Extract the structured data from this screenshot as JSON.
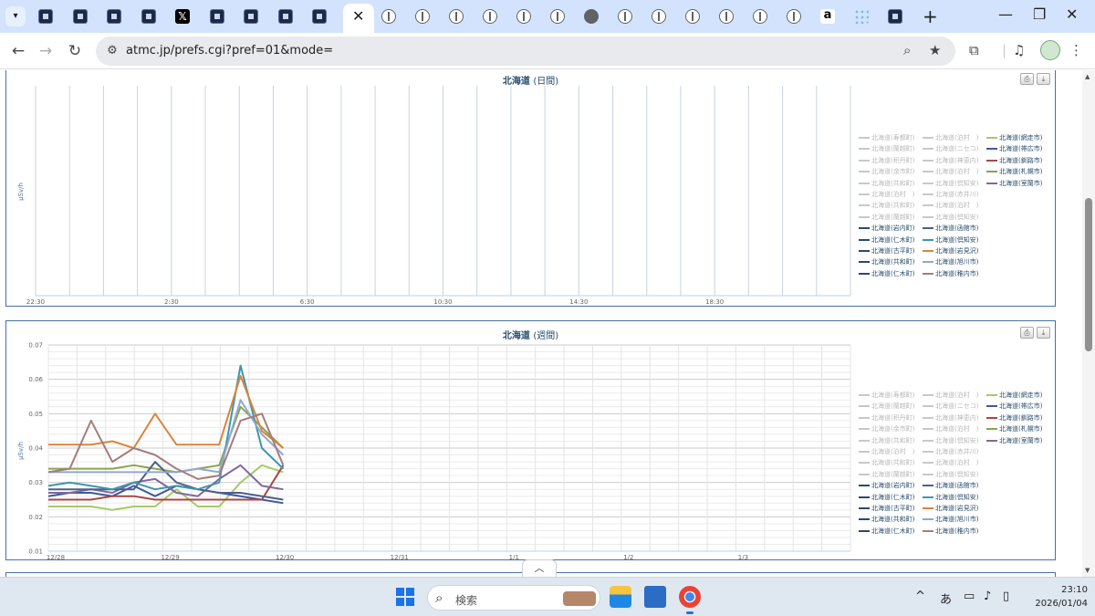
{
  "browser": {
    "url": "atmc.jp/prefs.cgi?pref=01&mode=",
    "tab_count": 27,
    "active_tab_index": 9
  },
  "page": {
    "panels": [
      {
        "title_main": "北海道",
        "title_sub": "(日間)",
        "ylabel": "µSv/h",
        "xticks": [
          "22:30",
          "2:30",
          "6:30",
          "10:30",
          "14:30",
          "18:30"
        ]
      },
      {
        "title_main": "北海道",
        "title_sub": "(週間)",
        "ylabel": "µSv/h",
        "yticks": [
          "0.07",
          "0.06",
          "0.05",
          "0.04",
          "0.03",
          "0.02",
          "0.01"
        ],
        "xticks": [
          "12/28",
          "12/29",
          "12/30",
          "12/31",
          "1/1",
          "1/2",
          "1/3"
        ]
      }
    ],
    "legend": {
      "col1": [
        "北海道(寿都町)",
        "北海道(蘭越町)",
        "北海道(积丹町)",
        "北海道(余市町)",
        "北海道(共和町)",
        "北海道(泊村　)",
        "北海道(共和町)",
        "北海道(蘭越町)",
        "北海道(岩内町)",
        "北海道(仁木町)",
        "北海道(古平町)",
        "北海道(共和町)",
        "北海道(仁木町)"
      ],
      "col2": [
        "北海道(泊村　)",
        "北海道(ニセコ)",
        "北海道(神恵内)",
        "北海道(泊村　)",
        "北海道(倶知安)",
        "北海道(赤井川)",
        "北海道(泊村　)",
        "北海道(倶知安)",
        "北海道(函館市)",
        "北海道(倶知安)",
        "北海道(岩見沢)",
        "北海道(旭川市)",
        "北海道(稚内市)"
      ],
      "col3": [
        "北海道(網走市)",
        "北海道(帯広市)",
        "北海道(釧路市)",
        "北海道(札幌市)",
        "北海道(室蘭市)"
      ]
    }
  },
  "taskbar": {
    "search_placeholder": "検索",
    "ime": "あ",
    "time": "23:10",
    "date": "2026/01/04"
  },
  "chart_data": [
    {
      "type": "line",
      "title": "北海道 (日間)",
      "ylabel": "µSv/h",
      "x": [
        "22:30",
        "2:30",
        "6:30",
        "10:30",
        "14:30",
        "18:30"
      ],
      "series": []
    },
    {
      "type": "line",
      "title": "北海道 (週間)",
      "ylabel": "µSv/h",
      "ylim": [
        0.01,
        0.07
      ],
      "x": [
        "12/28",
        "12/29",
        "12/30",
        "12/31",
        "1/1",
        "1/2",
        "1/3"
      ],
      "series": [
        {
          "name": "北海道(網走市)",
          "color": "#a6c96a",
          "values": [
            0.023,
            0.023,
            0.023,
            0.022,
            0.023,
            0.023,
            0.028,
            0.023,
            0.023,
            0.03,
            0.035,
            0.033
          ]
        },
        {
          "name": "北海道(帯広市)",
          "color": "#3d5a98",
          "values": [
            0.026,
            0.027,
            0.027,
            0.026,
            0.029,
            0.026,
            0.029,
            0.028,
            0.027,
            0.026,
            0.025,
            0.024
          ]
        },
        {
          "name": "北海道(釧路市)",
          "color": "#aa4643",
          "values": [
            0.025,
            0.025,
            0.025,
            0.026,
            0.026,
            0.025,
            0.025,
            0.025,
            0.025,
            0.025,
            0.025,
            0.035
          ]
        },
        {
          "name": "北海道(札幌市)",
          "color": "#89a54e",
          "values": [
            0.034,
            0.034,
            0.034,
            0.034,
            0.035,
            0.034,
            0.033,
            0.034,
            0.035,
            0.052,
            0.046,
            0.04
          ]
        },
        {
          "name": "北海道(室蘭市)",
          "color": "#80699b",
          "values": [
            0.027,
            0.027,
            0.028,
            0.027,
            0.03,
            0.031,
            0.027,
            0.026,
            0.031,
            0.035,
            0.029,
            0.028
          ]
        },
        {
          "name": "北海道(函館市)",
          "color": "#4d5f8a",
          "values": [
            0.028,
            0.028,
            0.028,
            0.028,
            0.028,
            0.036,
            0.03,
            0.028,
            0.027,
            0.027,
            0.026,
            0.025
          ]
        },
        {
          "name": "北海道(倶知安)",
          "color": "#3d96ae",
          "values": [
            0.029,
            0.03,
            0.029,
            0.028,
            0.03,
            0.028,
            0.029,
            0.028,
            0.03,
            0.064,
            0.04,
            0.034
          ]
        },
        {
          "name": "北海道(岩見沢)",
          "color": "#db843d",
          "values": [
            0.041,
            0.041,
            0.041,
            0.042,
            0.04,
            0.05,
            0.041,
            0.041,
            0.041,
            0.061,
            0.045,
            0.04
          ]
        },
        {
          "name": "北海道(旭川市)",
          "color": "#92a8cd",
          "values": [
            0.033,
            0.033,
            0.033,
            0.033,
            0.033,
            0.033,
            0.033,
            0.034,
            0.033,
            0.054,
            0.044,
            0.038
          ]
        },
        {
          "name": "北海道(稚内市)",
          "color": "#a47d7c",
          "values": [
            0.033,
            0.034,
            0.048,
            0.036,
            0.04,
            0.038,
            0.034,
            0.031,
            0.032,
            0.048,
            0.05,
            0.035
          ]
        }
      ]
    }
  ]
}
